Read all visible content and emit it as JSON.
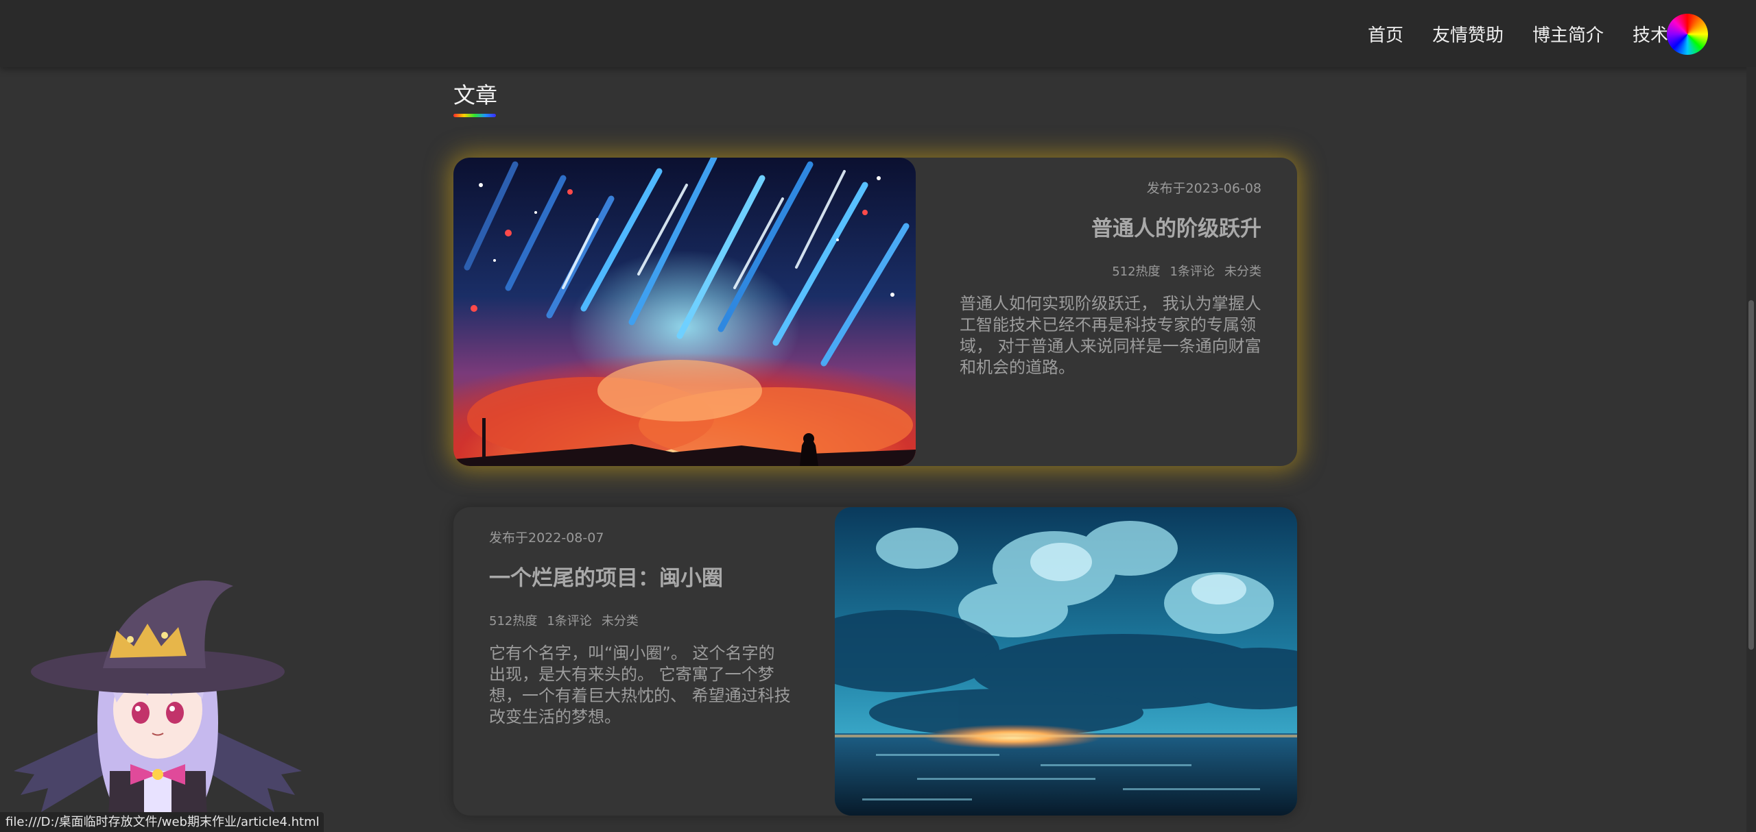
{
  "nav": {
    "items": [
      "首页",
      "友情赞助",
      "博主简介",
      "技术栈"
    ],
    "avatar_icon": "rainbow-avatar-icon"
  },
  "section": {
    "title": "文章"
  },
  "articles": [
    {
      "date": "发布于2023-06-08",
      "title": "普通人的阶级跃升",
      "heat": "512热度",
      "comments": "1条评论",
      "category": "未分类",
      "excerpt": "普通人如何实现阶级跃迁， 我认为掌握人工智能技术已经不再是科技专家的专属领域， 对于普通人来说同样是一条通向财富和机会的道路。",
      "image_icon": "meteor-shower-illustration",
      "accent": "#d6a814"
    },
    {
      "date": "发布于2022-08-07",
      "title": "一个烂尾的项目：闽小圈",
      "heat": "512热度",
      "comments": "1条评论",
      "category": "未分类",
      "excerpt": "它有个名字，叫“闽小圈”。 这个名字的出现，是大有来头的。 它寄寓了一个梦想，一个有着巨大热忱的、 希望通过科技改变生活的梦想。",
      "image_icon": "sunset-sea-clouds-illustration"
    }
  ],
  "mascot_icon": "witch-girl-mascot",
  "status_url": "file:///D:/桌面临时存放文件/web期末作业/article4.html",
  "colors": {
    "background": "#333333",
    "topbar": "#2a2a2a",
    "card": "#353535",
    "glow": "#d6a814"
  }
}
